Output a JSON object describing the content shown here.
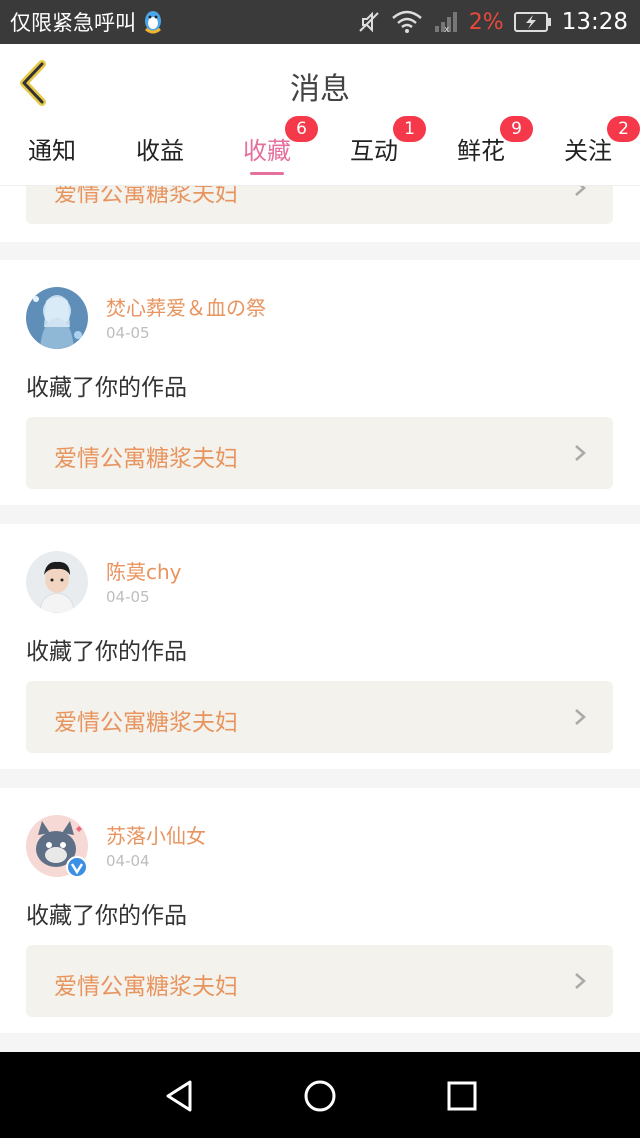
{
  "status_bar": {
    "notice": "仅限紧急呼叫",
    "battery": "2%",
    "time": "13:28"
  },
  "header": {
    "title": "消息",
    "back_icon": "back-chevron-icon"
  },
  "tabs": [
    {
      "label": "通知",
      "badge": ""
    },
    {
      "label": "收益",
      "badge": ""
    },
    {
      "label": "收藏",
      "badge": "6",
      "active": true
    },
    {
      "label": "互动",
      "badge": "1"
    },
    {
      "label": "鲜花",
      "badge": "9"
    },
    {
      "label": "关注",
      "badge": "2"
    }
  ],
  "feed": {
    "partial_work_title": "爱情公寓糖浆夫妇",
    "items": [
      {
        "user": "焚心葬爱＆血の祭",
        "date": "04-05",
        "action": "收藏了你的作品",
        "work": "爱情公寓糖浆夫妇"
      },
      {
        "user": "陈莫chy",
        "date": "04-05",
        "action": "收藏了你的作品",
        "work": "爱情公寓糖浆夫妇"
      },
      {
        "user": "苏落小仙女",
        "date": "04-04",
        "action": "收藏了你的作品",
        "work": "爱情公寓糖浆夫妇"
      }
    ]
  },
  "colors": {
    "accent": "#e5709d",
    "username": "#e8945f",
    "badge": "#f5394a"
  }
}
